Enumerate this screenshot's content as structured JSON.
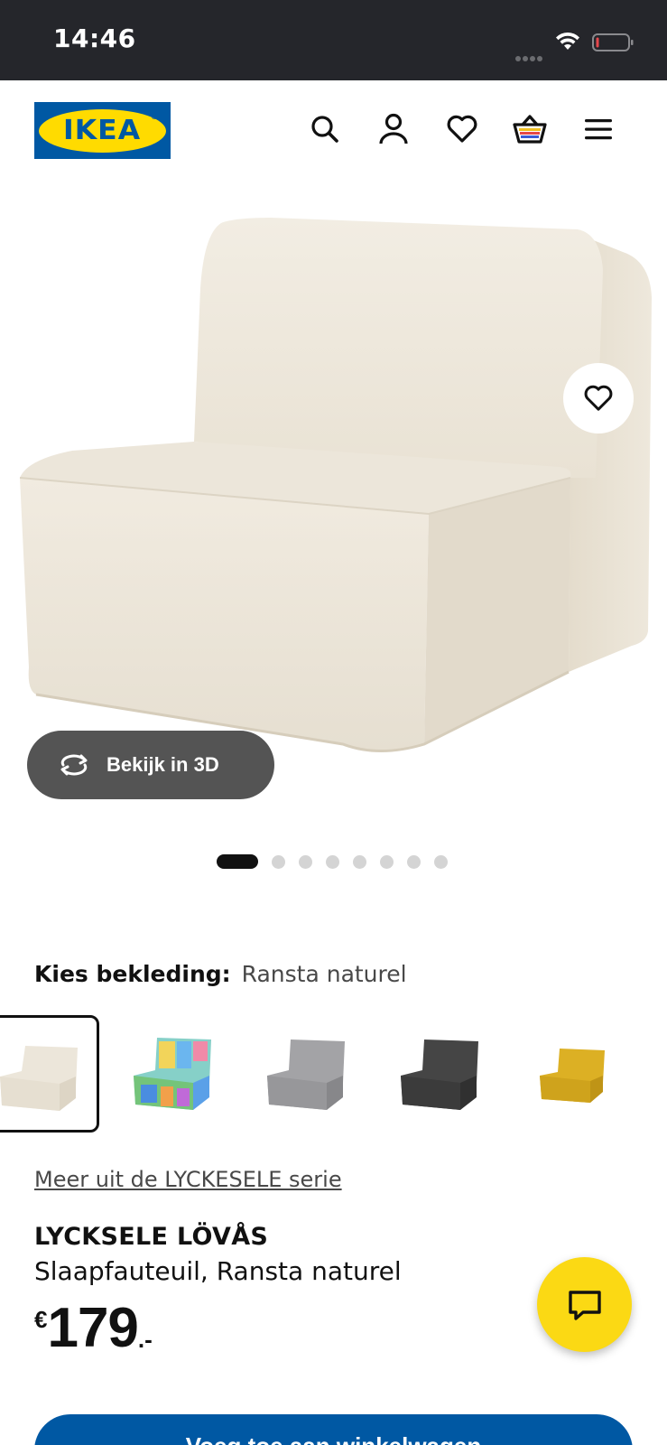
{
  "status_bar": {
    "time": "14:46"
  },
  "header": {
    "logo_text": "IKEA",
    "logo_reg": "®",
    "icons": [
      "search-icon",
      "account-icon",
      "heart-icon",
      "basket-icon",
      "menu-icon"
    ]
  },
  "hero": {
    "view_3d_label": "Bekijk in 3D",
    "image_count": 8,
    "active_image": 1
  },
  "covering": {
    "label": "Kies bekleding:",
    "value": "Ransta naturel",
    "swatches": [
      {
        "color": "#ece6da",
        "selected": true
      },
      {
        "color": "multicolor",
        "selected": false
      },
      {
        "color": "#9a9a9c",
        "selected": false
      },
      {
        "color": "#3c3c3c",
        "selected": false
      },
      {
        "color": "#d8a91c",
        "selected": false
      }
    ]
  },
  "series_link": "Meer uit de LYCKESELE serie",
  "product": {
    "name": "LYCKSELE LÖVÅS",
    "description": "Slaapfauteuil, Ransta naturel",
    "price": {
      "currency": "€",
      "amount": "179",
      "suffix": ".-"
    }
  },
  "cta_label": "Voeg toe aan winkelwagen",
  "colors": {
    "ikea_blue": "#0058a3",
    "ikea_yellow": "#ffdb00",
    "chat_yellow": "#fbd914",
    "status_bar": "#25262b"
  }
}
